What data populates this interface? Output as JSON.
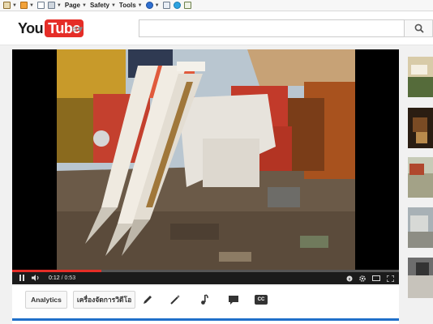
{
  "ie_toolbar": {
    "page_label": "Page",
    "safety_label": "Safety",
    "tools_label": "Tools"
  },
  "header": {
    "logo_you": "You",
    "logo_tube": "Tube",
    "search_placeholder": ""
  },
  "player": {
    "current_time": "0:12",
    "duration": "/ 0:53",
    "progress_fraction": 0.23
  },
  "actions": {
    "analytics_label": "Analytics",
    "video_manager_label": "เครื่องจัดการวิดีโอ",
    "cc_label": "CC"
  },
  "colors": {
    "brand_red": "#e52d27",
    "accent_blue": "#1f6fc9"
  },
  "icons": [
    "home-icon",
    "feeds-icon",
    "read-mail-icon",
    "print-icon",
    "help-icon",
    "skype-icon",
    "search-icon",
    "play-pause-icon",
    "volume-icon",
    "captions-icon",
    "settings-icon",
    "theater-icon",
    "fullscreen-icon",
    "edit-pencil-icon",
    "enhancements-wand-icon",
    "audio-note-icon",
    "annotations-icon",
    "subtitles-cc-icon"
  ]
}
